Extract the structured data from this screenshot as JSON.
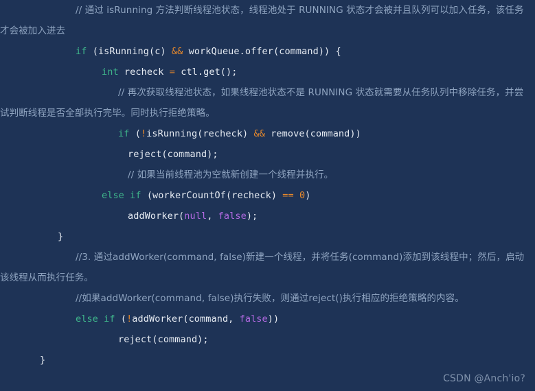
{
  "editor": {
    "background_color": "#1e3356",
    "language": "java",
    "colors": {
      "default_text": "#e6ebf2",
      "comment": "#8fa4c0",
      "keyword": "#3fb68b",
      "operator": "#e8892b",
      "number": "#e8892b",
      "literal": "#b36ae2"
    }
  },
  "lines": [
    {
      "id": "l1",
      "type": "comment_wrapped",
      "indent": 4,
      "text": "// 通过 isRunning 方法判断线程池状态，线程池处于 RUNNING 状态才会被并且队列可以加入任务，该任务才会被加入进去"
    },
    {
      "id": "l2",
      "type": "code",
      "indent": 4,
      "tokens": [
        {
          "t": "if",
          "c": "keyword"
        },
        {
          "t": " (isRunning(c) ",
          "c": "text"
        },
        {
          "t": "&&",
          "c": "operator"
        },
        {
          "t": " workQueue.offer(command)) {",
          "c": "text"
        }
      ]
    },
    {
      "id": "l3",
      "type": "code",
      "indent": 5,
      "tokens": [
        {
          "t": "int",
          "c": "keyword"
        },
        {
          "t": " recheck ",
          "c": "text"
        },
        {
          "t": "=",
          "c": "operator"
        },
        {
          "t": " ctl.get();",
          "c": "text"
        }
      ]
    },
    {
      "id": "l4",
      "type": "comment_wrapped",
      "indent": 6,
      "text": "// 再次获取线程池状态，如果线程池状态不是 RUNNING 状态就需要从任务队列中移除任务，并尝试判断线程是否全部执行完毕。同时执行拒绝策略。"
    },
    {
      "id": "l5",
      "type": "code",
      "indent": 6,
      "tokens": [
        {
          "t": "if",
          "c": "keyword"
        },
        {
          "t": " (",
          "c": "text"
        },
        {
          "t": "!",
          "c": "operator"
        },
        {
          "t": "isRunning(recheck) ",
          "c": "text"
        },
        {
          "t": "&&",
          "c": "operator"
        },
        {
          "t": " remove(command))",
          "c": "text"
        }
      ]
    },
    {
      "id": "l6",
      "type": "code",
      "indent": 8,
      "tokens": [
        {
          "t": "reject(command);",
          "c": "text"
        }
      ]
    },
    {
      "id": "l7",
      "type": "comment",
      "indent": 8,
      "text": "// 如果当前线程池为空就新创建一个线程并执行。"
    },
    {
      "id": "l8",
      "type": "code",
      "indent": 5,
      "tokens": [
        {
          "t": "else if",
          "c": "keyword"
        },
        {
          "t": " (workerCountOf(recheck) ",
          "c": "text"
        },
        {
          "t": "==",
          "c": "operator"
        },
        {
          "t": " ",
          "c": "text"
        },
        {
          "t": "0",
          "c": "number"
        },
        {
          "t": ")",
          "c": "text"
        }
      ]
    },
    {
      "id": "l9",
      "type": "code",
      "indent": 8,
      "tokens": [
        {
          "t": "addWorker(",
          "c": "text"
        },
        {
          "t": "null",
          "c": "literal"
        },
        {
          "t": ", ",
          "c": "text"
        },
        {
          "t": "false",
          "c": "literal"
        },
        {
          "t": ");",
          "c": "text"
        }
      ]
    },
    {
      "id": "l10",
      "type": "code",
      "indent": 3,
      "tokens": [
        {
          "t": "}",
          "c": "text"
        }
      ]
    },
    {
      "id": "l11",
      "type": "comment_wrapped",
      "indent": 4,
      "text": "//3. 通过addWorker(command, false)新建一个线程，并将任务(command)添加到该线程中；然后，启动该线程从而执行任务。"
    },
    {
      "id": "l12",
      "type": "comment_wrapped",
      "indent": 4,
      "text": "//如果addWorker(command, false)执行失败，则通过reject()执行相应的拒绝策略的内容。"
    },
    {
      "id": "l13",
      "type": "code",
      "indent": 4,
      "tokens": [
        {
          "t": "else if",
          "c": "keyword"
        },
        {
          "t": " (",
          "c": "text"
        },
        {
          "t": "!",
          "c": "operator"
        },
        {
          "t": "addWorker(command, ",
          "c": "text"
        },
        {
          "t": "false",
          "c": "literal"
        },
        {
          "t": "))",
          "c": "text"
        }
      ]
    },
    {
      "id": "l14",
      "type": "code",
      "indent": 6,
      "tokens": [
        {
          "t": "reject(command);",
          "c": "text"
        }
      ]
    },
    {
      "id": "l15",
      "type": "code",
      "indent": 2,
      "tokens": [
        {
          "t": "}",
          "c": "text"
        }
      ]
    }
  ],
  "watermark": {
    "text": "CSDN @Anch'io?"
  }
}
